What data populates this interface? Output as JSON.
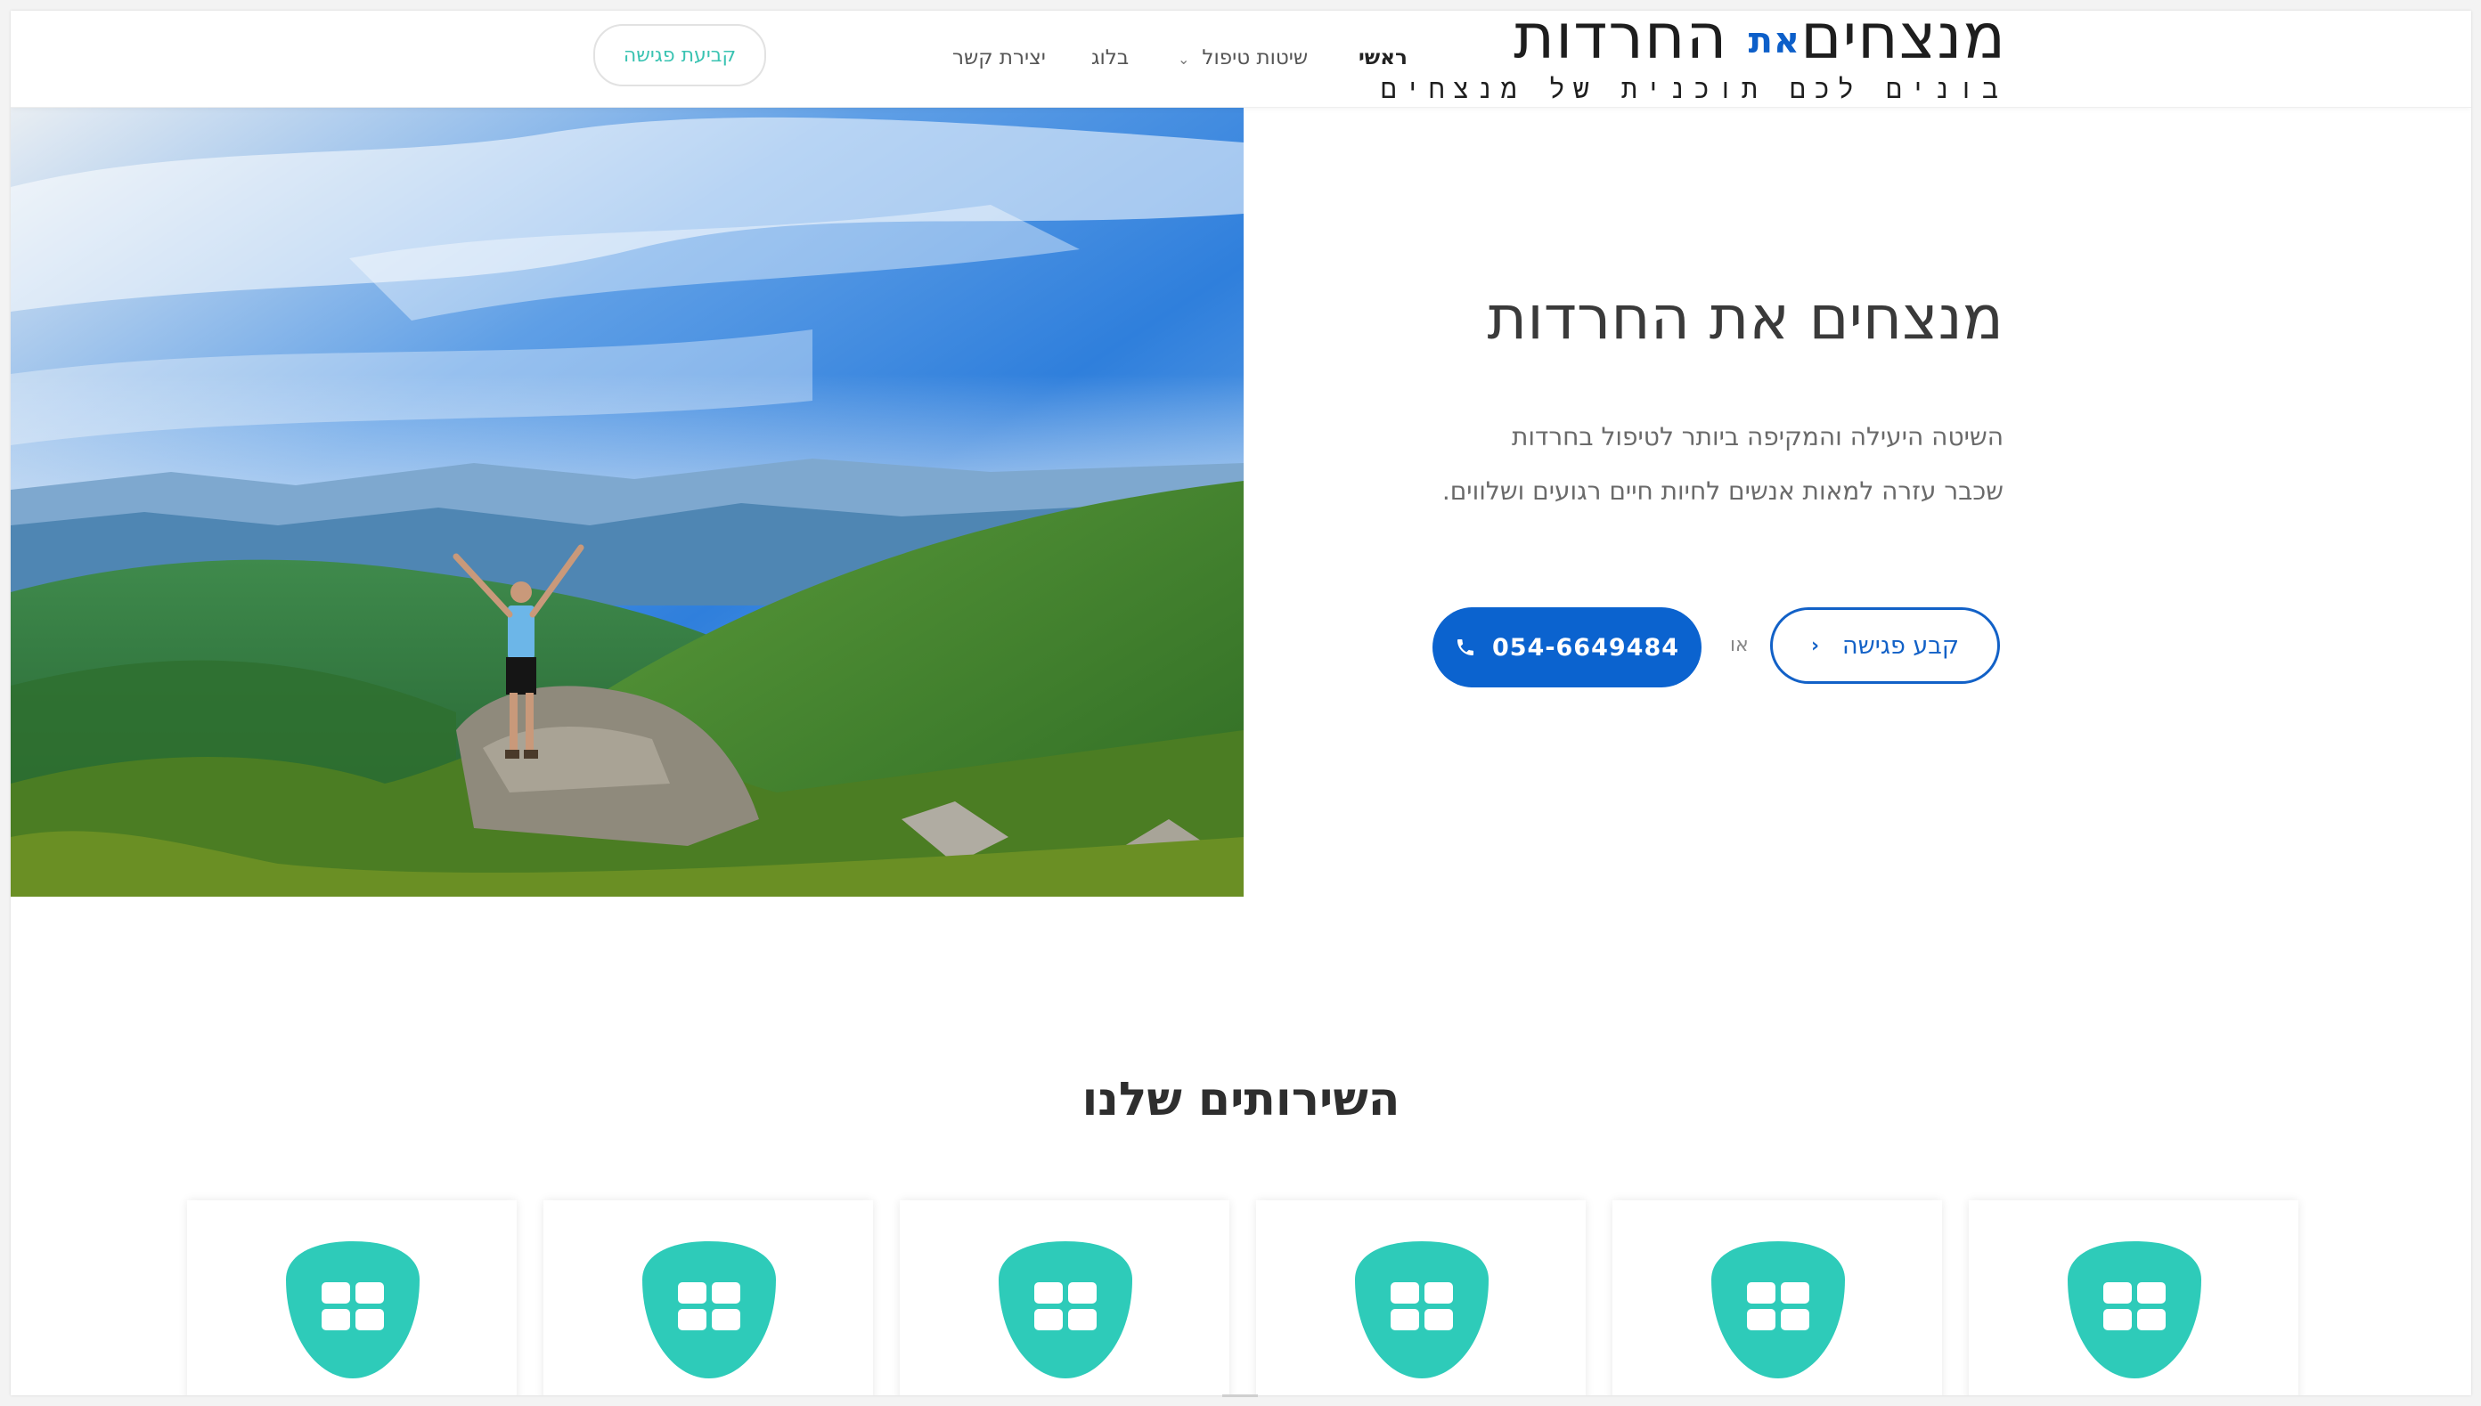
{
  "header": {
    "logo": {
      "title_part1": "מנצחים",
      "title_accent": "את",
      "title_part2": "החרדות",
      "tagline": "בונים לכם תוכנית של מנצחים"
    },
    "nav": [
      {
        "label": "ראשי",
        "active": true
      },
      {
        "label": "שיטות טיפול",
        "has_dropdown": true
      },
      {
        "label": "בלוג"
      },
      {
        "label": "יצירת קשר"
      }
    ],
    "cta_label": "קביעת פגישה"
  },
  "hero": {
    "image_alt": "man with raised arms on mountain top",
    "title": "מנצחים את החרדות",
    "text_line1": "השיטה היעילה והמקיפה ביותר לטיפול בחרדות",
    "text_line2": "שכבר עזרה למאות אנשים לחיות חיים רגועים ושלווים.",
    "btn_meeting": "קבע פגישה",
    "or_text": "או",
    "phone": "054-6649484"
  },
  "services": {
    "title": "השירותים שלנו",
    "cards": [
      {
        "icon": "grid-shield-icon"
      },
      {
        "icon": "grid-shield-icon"
      },
      {
        "icon": "grid-shield-icon"
      },
      {
        "icon": "grid-shield-icon"
      },
      {
        "icon": "grid-shield-icon"
      },
      {
        "icon": "grid-shield-icon"
      }
    ]
  },
  "colors": {
    "accent_blue": "#0b63cf",
    "teal": "#2ecbb9",
    "header_cta_text": "#3ac3b2"
  }
}
